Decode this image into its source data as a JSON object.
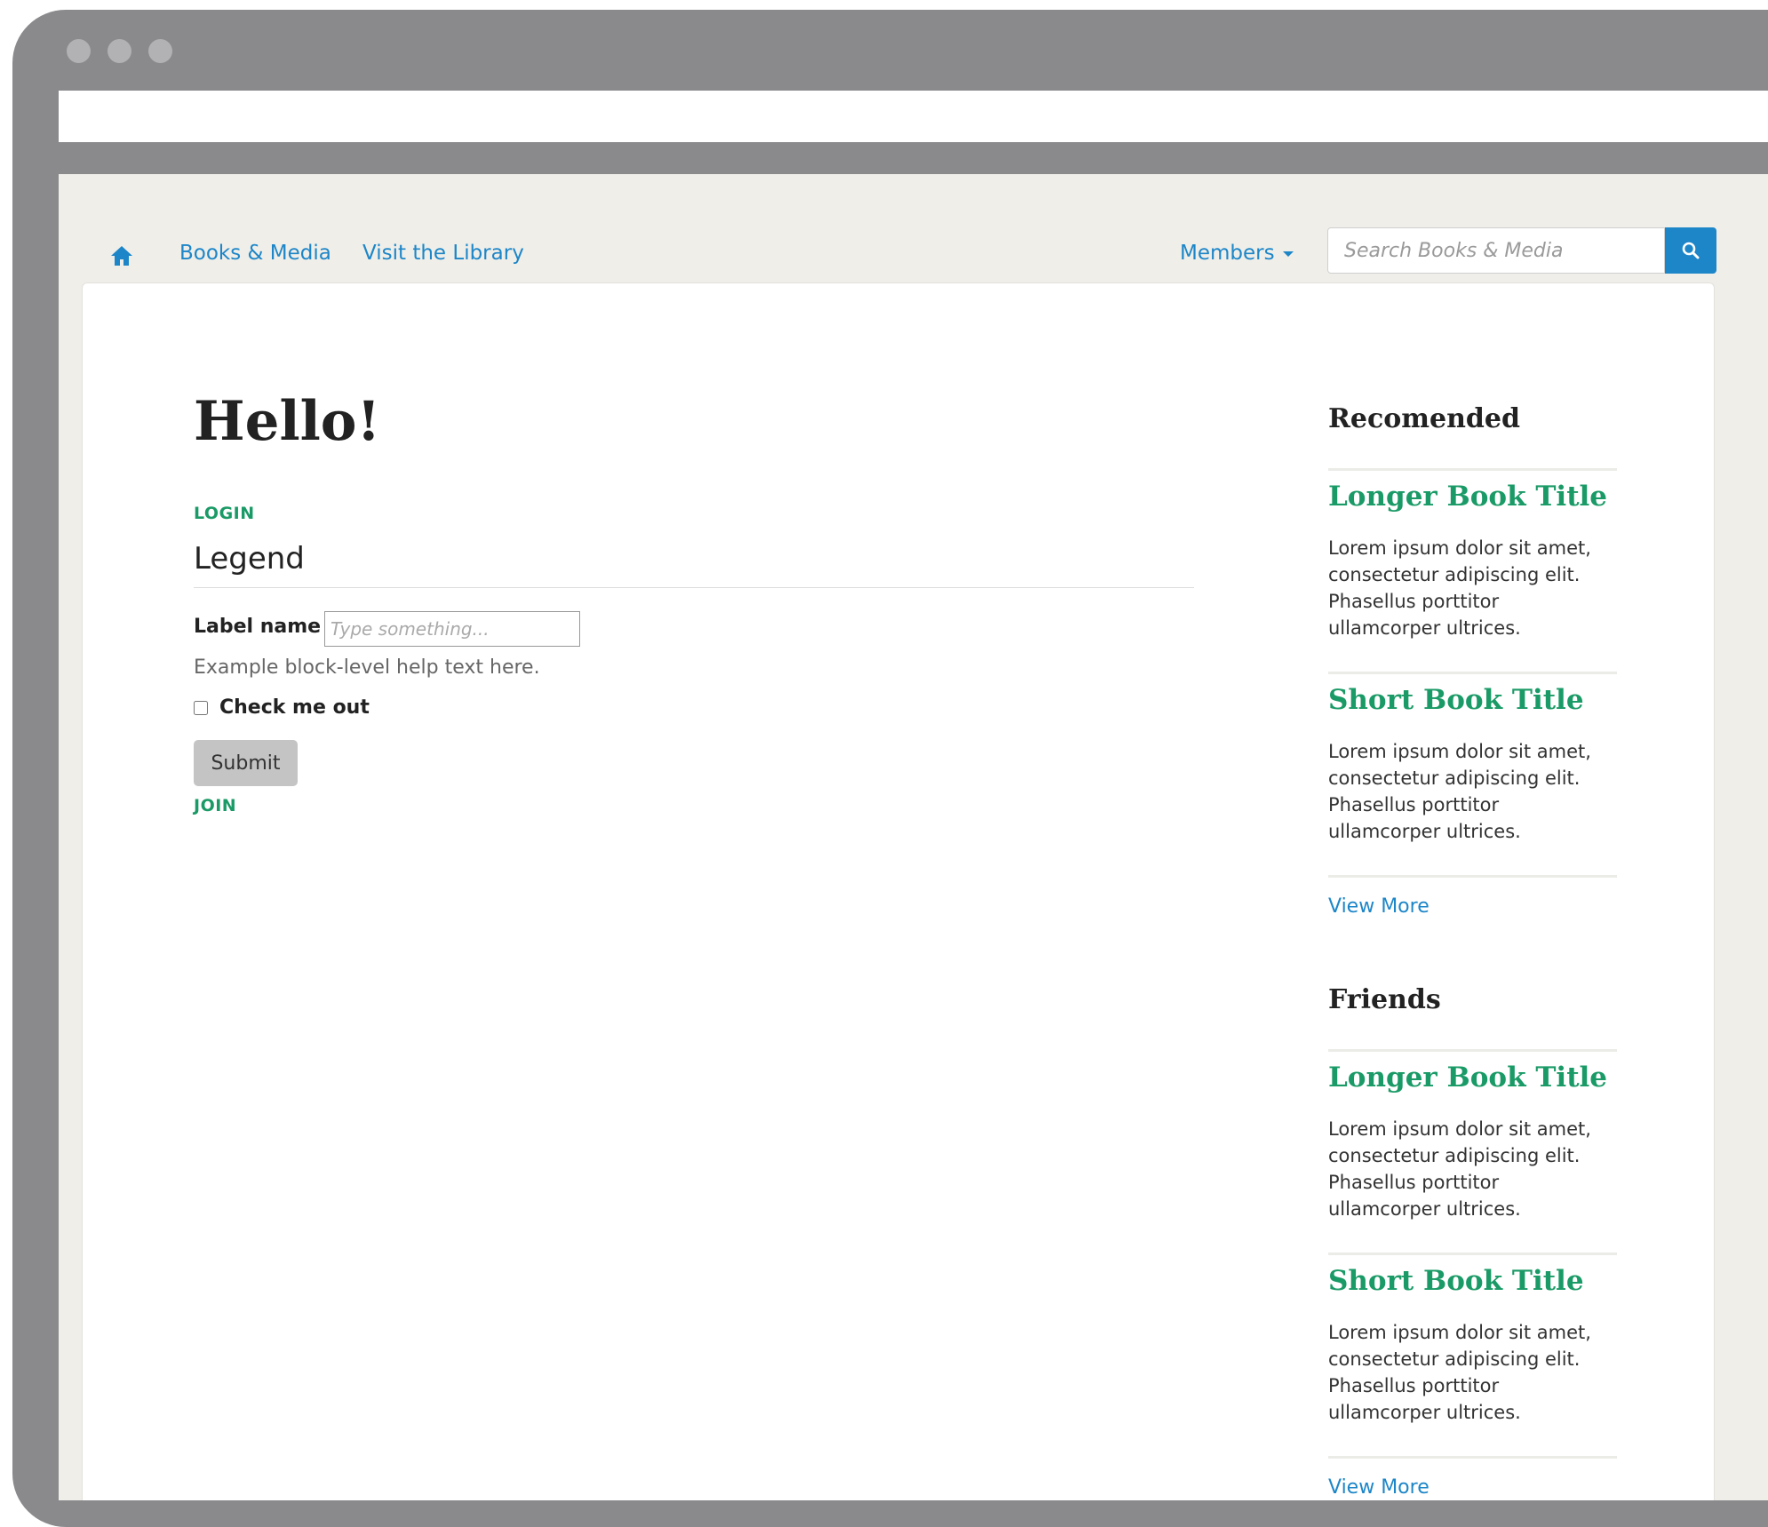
{
  "nav": {
    "links": [
      "Books & Media",
      "Visit the Library"
    ],
    "members_label": "Members",
    "search_placeholder": "Search Books & Media"
  },
  "main": {
    "title": "Hello!",
    "login_label": "LOGIN",
    "legend": "Legend",
    "field_label": "Label name",
    "field_placeholder": "Type something...",
    "help_text": "Example block-level help text here.",
    "checkbox_label": "Check me out",
    "submit_label": "Submit",
    "join_label": "JOIN"
  },
  "sidebar": {
    "sections": [
      {
        "heading": "Recomended",
        "books": [
          {
            "title": "Longer Book Title",
            "lines": [
              "Lorem ipsum dolor sit amet,",
              "consectetur adipiscing elit.",
              "Phasellus porttitor",
              "ullamcorper ultrices."
            ]
          },
          {
            "title": "Short Book Title",
            "lines": [
              "Lorem ipsum dolor sit amet,",
              "consectetur adipiscing elit.",
              "Phasellus porttitor",
              "ullamcorper ultrices."
            ]
          }
        ],
        "view_more": "View More"
      },
      {
        "heading": "Friends",
        "books": [
          {
            "title": "Longer Book Title",
            "lines": [
              "Lorem ipsum dolor sit amet,",
              "consectetur adipiscing elit.",
              "Phasellus porttitor",
              "ullamcorper ultrices."
            ]
          },
          {
            "title": "Short Book Title",
            "lines": [
              "Lorem ipsum dolor sit amet,",
              "consectetur adipiscing elit.",
              "Phasellus porttitor",
              "ullamcorper ultrices."
            ]
          }
        ],
        "view_more": "View More"
      }
    ]
  },
  "colors": {
    "link_blue": "#1d86c8",
    "accent_green": "#1a9a66",
    "frame_gray": "#8a8a8d",
    "page_bg": "#efeee9"
  }
}
